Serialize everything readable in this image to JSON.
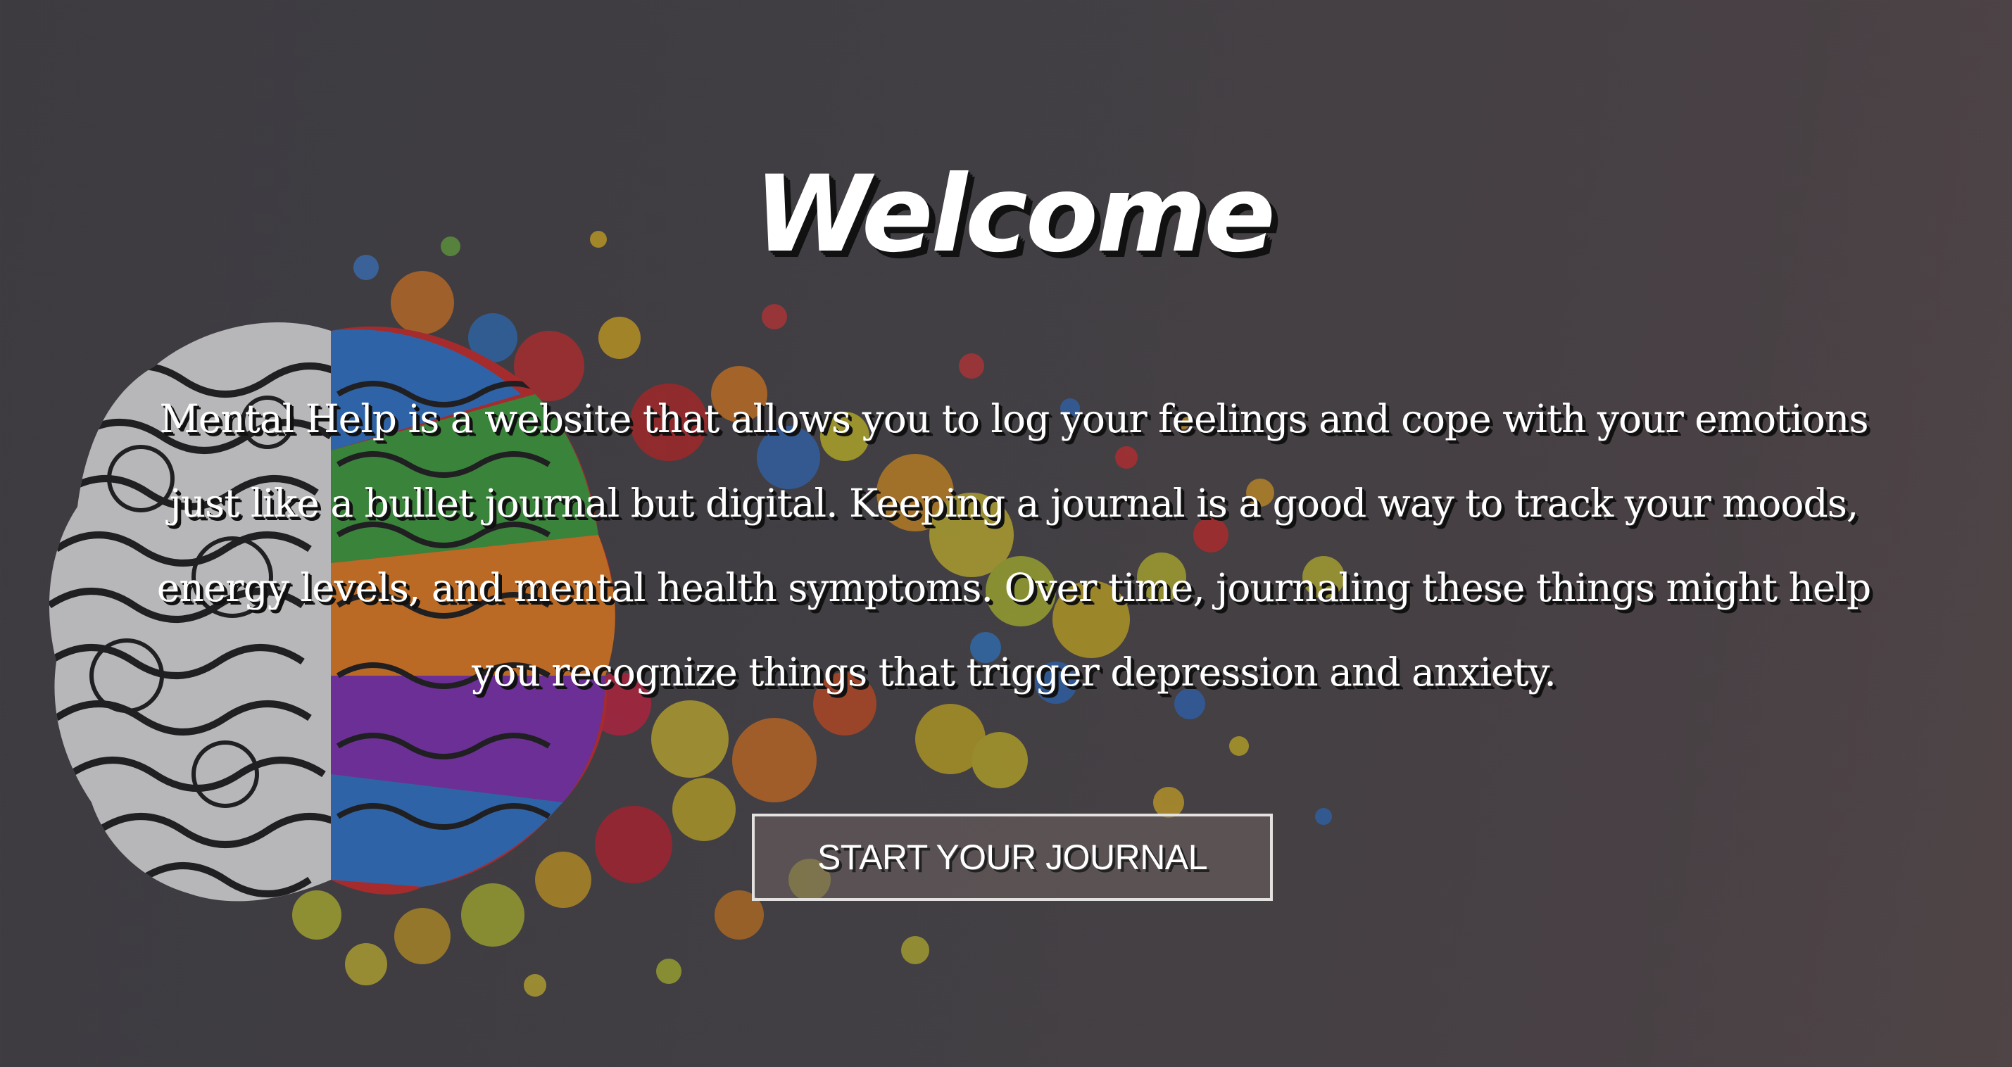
{
  "hero": {
    "title": "Welcome",
    "intro": "Mental Help is a website that allows you to log your feelings and cope with your emotions just like a bullet journal but digital. Keeping a journal is a good way to track your moods, energy levels, and mental health symptoms. Over time, journaling these things might help you recognize things that trigger depression and anxiety.",
    "cta_label": "START YOUR JOURNAL",
    "background_image": "colorful-brain-splash-illustration"
  },
  "colors": {
    "text": "#ffffff",
    "text_shadow": "#111111",
    "button_border": "#e4e2e0"
  }
}
